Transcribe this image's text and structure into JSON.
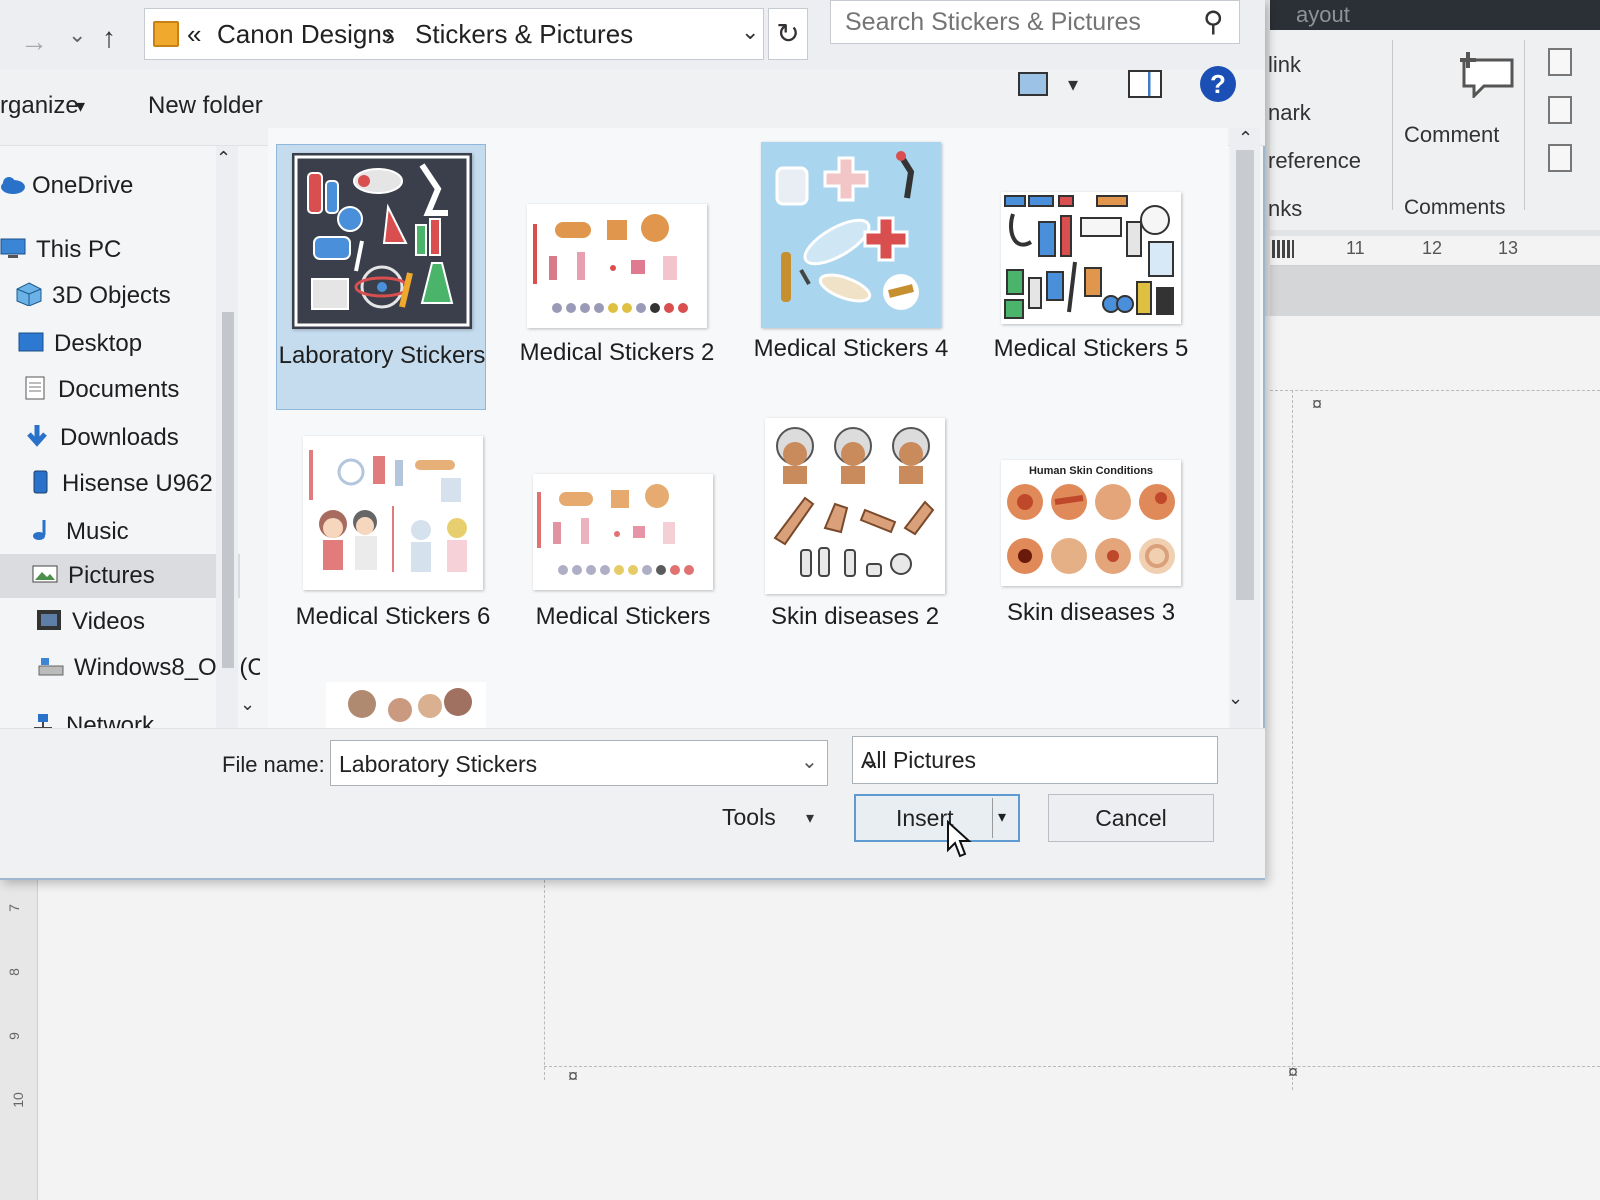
{
  "word": {
    "ribbon_title": "ayout",
    "links": [
      "link",
      "nark",
      "reference",
      "nks"
    ],
    "comment_label": "Comment",
    "comments_group": "Comments",
    "ruler_numbers": [
      "11",
      "12",
      "13"
    ],
    "left_ruler": [
      "7",
      "8",
      "9",
      "10"
    ],
    "para_mark": "¤"
  },
  "nav": {
    "back": "←",
    "forward": "→",
    "recent": "⌄",
    "up": "↑",
    "path_prefix": "«",
    "path": [
      "Canon Designs",
      "Stickers & Pictures"
    ],
    "separator": "›",
    "dropdown": "⌄",
    "refresh": "↻"
  },
  "search": {
    "placeholder": "Search Stickers & Pictures"
  },
  "toolbar": {
    "organize": "rganize",
    "organize_arrow": "▾",
    "new_folder": "New folder",
    "view_dropdown": "▾",
    "help": "?"
  },
  "sidebar": {
    "items": [
      {
        "label": "OneDrive",
        "icon": "cloud-icon"
      },
      {
        "label": "This PC",
        "icon": "computer-icon"
      },
      {
        "label": "3D Objects",
        "icon": "cube-icon"
      },
      {
        "label": "Desktop",
        "icon": "desktop-icon"
      },
      {
        "label": "Documents",
        "icon": "document-icon"
      },
      {
        "label": "Downloads",
        "icon": "download-icon"
      },
      {
        "label": "Hisense U962",
        "icon": "phone-icon"
      },
      {
        "label": "Music",
        "icon": "music-icon"
      },
      {
        "label": "Pictures",
        "icon": "pictures-icon"
      },
      {
        "label": "Videos",
        "icon": "video-icon"
      },
      {
        "label": "Windows8_OS (C",
        "icon": "drive-icon"
      },
      {
        "label": "Network",
        "icon": "network-icon"
      }
    ],
    "selected": "Pictures",
    "scroll_up": "⌃",
    "scroll_down": "⌄"
  },
  "files": [
    {
      "name": "Laboratory Stickers",
      "selected": true
    },
    {
      "name": "Medical Stickers 2",
      "selected": false
    },
    {
      "name": "Medical Stickers 4",
      "selected": false
    },
    {
      "name": "Medical Stickers 5",
      "selected": false
    },
    {
      "name": "Medical Stickers 6",
      "selected": false
    },
    {
      "name": "Medical Stickers",
      "selected": false
    },
    {
      "name": "Skin diseases 2",
      "selected": false
    },
    {
      "name": "Skin diseases 3",
      "selected": false
    }
  ],
  "thumb_text": {
    "skin_title": "Human Skin Conditions"
  },
  "grid_scroll": {
    "up": "⌃",
    "down": "⌄"
  },
  "footer": {
    "file_name_label": "File name:",
    "file_name_value": "Laboratory Stickers",
    "file_type": "All Pictures",
    "chevron": "⌄",
    "tools_label": "Tools",
    "tools_arrow": "▾",
    "insert_label": "Insert",
    "insert_arrow": "▾",
    "cancel_label": "Cancel"
  },
  "colors": {
    "selection_bg": "#c5dcee",
    "help_blue": "#1c4fb6",
    "folder": "#f0a92d",
    "lab_thumb_bg": "#3a3f4b",
    "med4_thumb_bg": "#a9d5ef"
  }
}
